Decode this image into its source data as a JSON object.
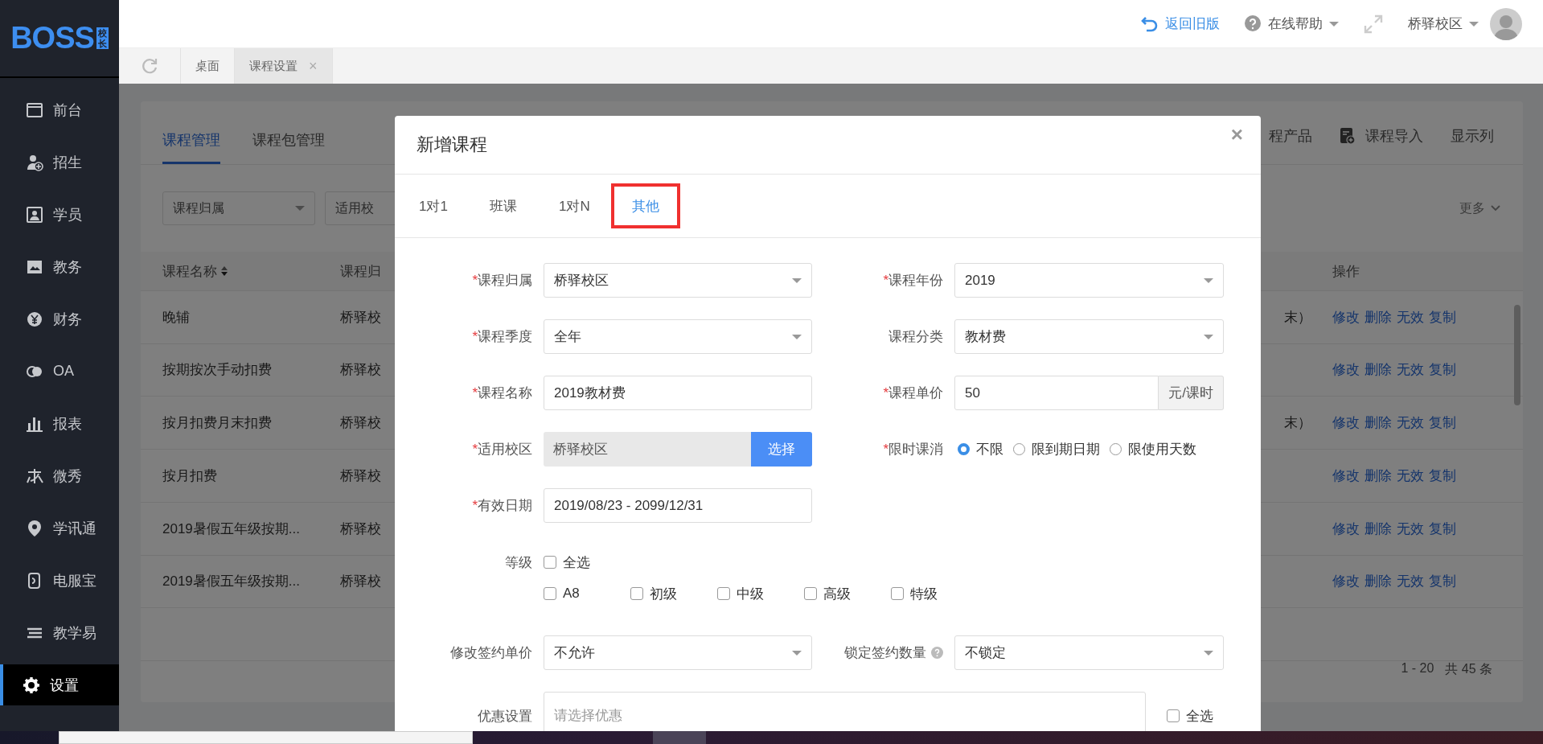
{
  "sidebar": {
    "logo_text": "BOSS",
    "logo_badge": "校长",
    "items": [
      {
        "label": "前台",
        "selected": false
      },
      {
        "label": "招生",
        "selected": false
      },
      {
        "label": "学员",
        "selected": false
      },
      {
        "label": "教务",
        "selected": false
      },
      {
        "label": "财务",
        "selected": false
      },
      {
        "label": "OA",
        "selected": false
      },
      {
        "label": "报表",
        "selected": false
      },
      {
        "label": "微秀",
        "selected": false
      },
      {
        "label": "学讯通",
        "selected": false
      },
      {
        "label": "电服宝",
        "selected": false
      },
      {
        "label": "教学易",
        "selected": false
      },
      {
        "label": "设置",
        "selected": true
      }
    ]
  },
  "header": {
    "back_link": "返回旧版",
    "help_menu": "在线帮助",
    "campus_menu": "桥驿校区"
  },
  "page_tabs": [
    {
      "label": "桌面",
      "selected": false
    },
    {
      "label": "课程设置",
      "selected": true,
      "close": "×"
    }
  ],
  "course_page": {
    "tabs": [
      {
        "label": "课程管理",
        "selected": true
      },
      {
        "label": "课程包管理",
        "selected": false
      }
    ],
    "toolbar": [
      {
        "label": "程产品",
        "kind": "plain"
      },
      {
        "label": "课程导入",
        "kind": "import"
      },
      {
        "label": "显示列",
        "kind": "plain"
      }
    ],
    "filters": [
      "课程归属",
      "适用校"
    ],
    "more": "更多",
    "table": {
      "columns": [
        "课程名称",
        "课程归"
      ],
      "actions_column": "操作",
      "rows": [
        {
          "name": "晚辅",
          "campus": "桥驿校",
          "column_3": "末）",
          "actions": [
            "修改",
            "删除",
            "无效",
            "复制"
          ]
        },
        {
          "name": "按期按次手动扣费",
          "campus": "桥驿校",
          "actions": [
            "修改",
            "删除",
            "无效",
            "复制"
          ]
        },
        {
          "name": "按月扣费月末扣费",
          "campus": "桥驿校",
          "column_3": "末）",
          "actions": [
            "修改",
            "删除",
            "无效",
            "复制"
          ]
        },
        {
          "name": "按月扣费",
          "campus": "桥驿校",
          "actions": [
            "修改",
            "删除",
            "无效",
            "复制"
          ]
        },
        {
          "name": "2019暑假五年级按期...",
          "campus": "桥驿校",
          "actions": [
            "修改",
            "删除",
            "无效",
            "复制"
          ]
        },
        {
          "name": "2019暑假五年级按期...",
          "campus": "桥驿校",
          "actions": [
            "修改",
            "删除",
            "无效",
            "复制"
          ]
        }
      ]
    },
    "pagination": {
      "range": "1 - 20",
      "total": "共 45 条"
    }
  },
  "dialog": {
    "title": "新增课程",
    "close": "×",
    "tabs": [
      {
        "label": "1对1",
        "selected": false,
        "highlighted": false
      },
      {
        "label": "班课",
        "selected": false,
        "highlighted": false
      },
      {
        "label": "1对N",
        "selected": false,
        "highlighted": false
      },
      {
        "label": "其他",
        "selected": true,
        "highlighted": true
      }
    ],
    "rows": [
      [
        {
          "mark": "*",
          "label": "课程归属",
          "kind": "select",
          "value": "桥驿校区"
        },
        {
          "mark": "*",
          "label": "课程年份",
          "kind": "select",
          "value": "2019"
        }
      ],
      [
        {
          "mark": "*",
          "label": "课程季度",
          "kind": "select",
          "value": "全年"
        },
        {
          "label": "课程分类",
          "kind": "select",
          "value": "教材费"
        }
      ],
      [
        {
          "mark": "*",
          "label": "课程名称",
          "kind": "input",
          "value": "2019教材费"
        },
        {
          "mark": "*",
          "label": "课程单价",
          "kind": "input",
          "value": "50",
          "addon": "元/课时"
        }
      ],
      [
        {
          "mark": "*",
          "label": "适用校区",
          "kind": "picker",
          "value": "桥驿校区",
          "button": "选择"
        },
        {
          "mark": "*",
          "label": "限时课消",
          "kind": "radio",
          "options": [
            {
              "label": "不限",
              "selected": true
            },
            {
              "label": "限到期日期",
              "selected": false
            },
            {
              "label": "限使用天数",
              "selected": false
            }
          ]
        }
      ],
      [
        {
          "mark": "*",
          "label": "有效日期",
          "kind": "input",
          "value": "2019/08/23 - 2099/12/31"
        }
      ]
    ],
    "levels": {
      "label": "等级",
      "all": {
        "label": "全选",
        "checked": false
      },
      "options": [
        {
          "label": "A8",
          "checked": false
        },
        {
          "label": "初级",
          "checked": false
        },
        {
          "label": "中级",
          "checked": false
        },
        {
          "label": "高级",
          "checked": false
        },
        {
          "label": "特级",
          "checked": false
        }
      ]
    },
    "rows2": [
      [
        {
          "label": "修改签约单价",
          "kind": "select",
          "value": "不允许"
        },
        {
          "label": "锁定签约数量",
          "kind": "select",
          "value": "不锁定",
          "hint": true
        }
      ]
    ],
    "discount": {
      "label": "优惠设置",
      "placeholder": "请选择优惠",
      "all": {
        "label": "全选",
        "checked": false
      }
    }
  }
}
